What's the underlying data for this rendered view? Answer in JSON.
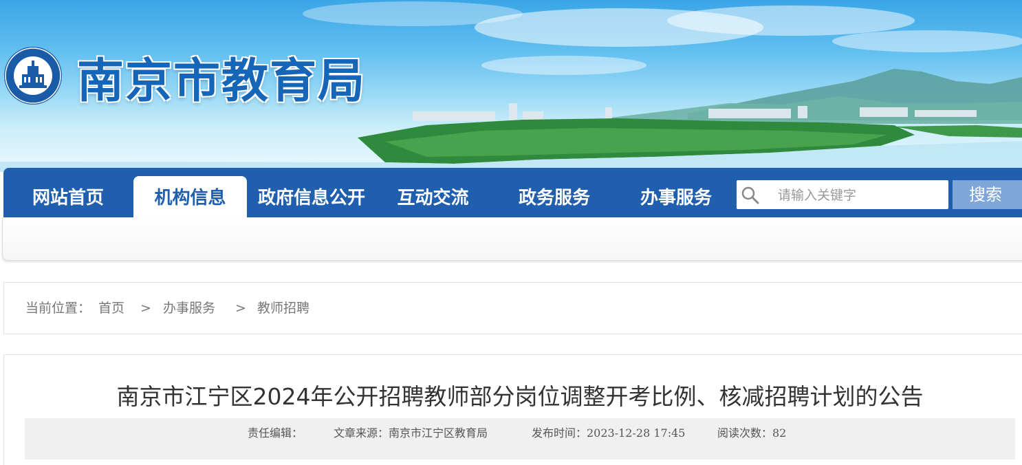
{
  "header": {
    "site_title": "南京市教育局",
    "emblem_icon": "nanjing-education-emblem-icon"
  },
  "nav": {
    "items": [
      {
        "label": "网站首页",
        "active": false
      },
      {
        "label": "机构信息",
        "active": true
      },
      {
        "label": "政府信息公开",
        "active": false
      },
      {
        "label": "互动交流",
        "active": false
      },
      {
        "label": "政务服务",
        "active": false
      },
      {
        "label": "办事服务",
        "active": false
      }
    ],
    "search": {
      "placeholder": "请输入关键字",
      "button_label": "搜索",
      "icon": "search-icon"
    }
  },
  "breadcrumb": {
    "prefix": "当前位置：",
    "items": [
      "首页",
      "办事服务",
      "教师招聘"
    ],
    "separator": ">"
  },
  "article": {
    "title": "南京市江宁区2024年公开招聘教师部分岗位调整开考比例、核减招聘计划的公告",
    "meta": {
      "editor": "责任编辑：",
      "source": "文章来源：南京市江宁区教育局",
      "publish_time": "发布时间：2023-12-28 17:45",
      "views": "阅读次数：82"
    }
  },
  "colors": {
    "nav_blue": "#1f5fae",
    "title_blue": "#1565b8",
    "search_button": "#7ea6d8"
  }
}
